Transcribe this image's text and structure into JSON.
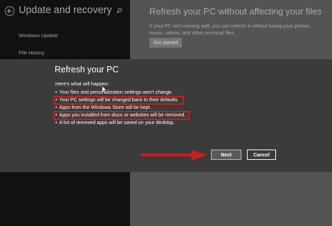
{
  "sidebar": {
    "title": "Update and recovery",
    "items": [
      {
        "label": "Windows Update"
      },
      {
        "label": "File History"
      }
    ]
  },
  "main": {
    "heading": "Refresh your PC without affecting your files",
    "description": "If your PC isn't running well, you can refresh it without losing your photos, music, videos, and other personal files.",
    "get_started_label": "Get started"
  },
  "dialog": {
    "title": "Refresh your PC",
    "subtitle": "Here's what will happen:",
    "bullets": [
      "Your files and personalization settings won't change.",
      "Your PC settings will be changed back to their defaults.",
      "Apps from the Windows Store will be kept.",
      "Apps you installed from discs or websites will be removed.",
      "A list of removed apps will be saved on your desktop."
    ],
    "highlighted_bullets": [
      1,
      3
    ],
    "next_label": "Next",
    "cancel_label": "Cancel"
  },
  "colors": {
    "annotation": "#cc1d1d",
    "dialog_bg": "#3b3b3b",
    "sidebar_bg": "#111111"
  },
  "icons": [
    "back-arrow-icon",
    "search-icon",
    "mouse-cursor-icon",
    "red-arrow-icon"
  ]
}
